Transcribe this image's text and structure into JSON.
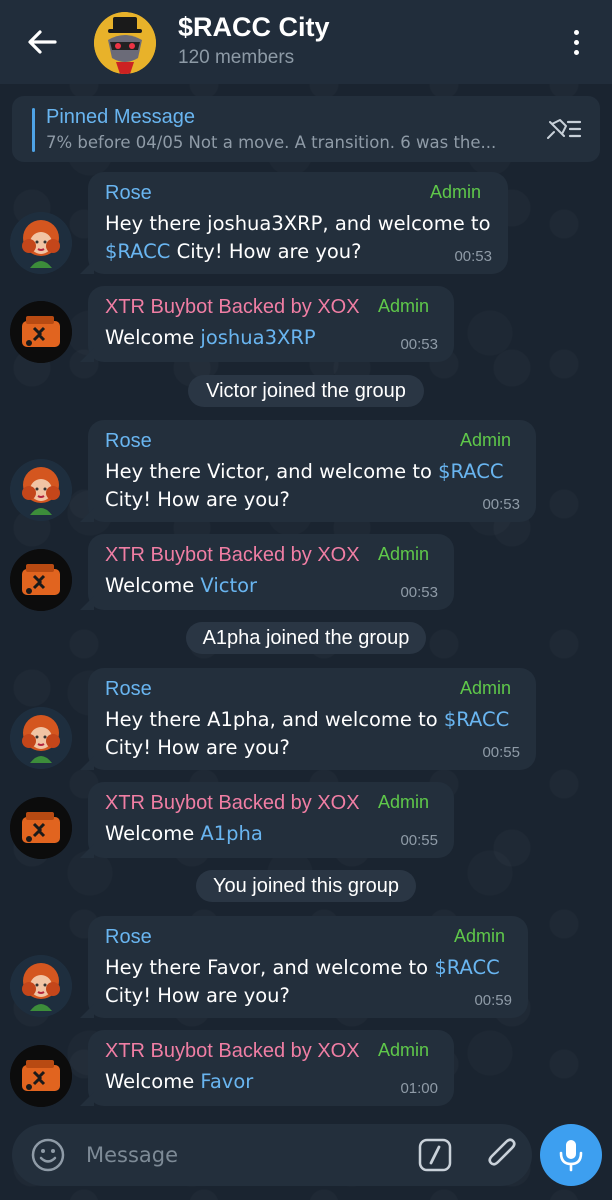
{
  "header": {
    "title": "$RACC City",
    "members": "120 members"
  },
  "pinned": {
    "title": "Pinned Message",
    "text": "7% before 04/05 Not a move. A transition. 6 was the..."
  },
  "messages": [
    {
      "sender": "Rose",
      "badge": "Admin",
      "line1_pre": "Hey there joshua3XRP, and welcome to",
      "line2_link": "$RACC",
      "line2_post": " City! How are you?",
      "time": "00:53"
    },
    {
      "sender": "XTR Buybot Backed by XOX",
      "badge": "Admin",
      "pre": "Welcome ",
      "link": "joshua3XRP",
      "time": "00:53"
    },
    {
      "service": "Victor joined the group"
    },
    {
      "sender": "Rose",
      "badge": "Admin",
      "line1_pre": "Hey there Victor, and welcome to ",
      "line1_link": "$RACC",
      "line2": "City! How are you?",
      "time": "00:53"
    },
    {
      "sender": "XTR Buybot Backed by XOX",
      "badge": "Admin",
      "pre": "Welcome ",
      "link": "Victor",
      "time": "00:53"
    },
    {
      "service": "A1pha joined the group"
    },
    {
      "sender": "Rose",
      "badge": "Admin",
      "line1_pre": "Hey there A1pha, and welcome to ",
      "line1_link": "$RACC",
      "line2": "City! How are you?",
      "time": "00:55"
    },
    {
      "sender": "XTR Buybot Backed by XOX",
      "badge": "Admin",
      "pre": "Welcome ",
      "link": "A1pha",
      "time": "00:55"
    },
    {
      "service": "You joined this group"
    },
    {
      "sender": "Rose",
      "badge": "Admin",
      "line1_pre": "Hey there Favor, and welcome to ",
      "line1_link": "$RACC",
      "line2": "City! How are you?",
      "time": "00:59"
    },
    {
      "sender": "XTR Buybot Backed by XOX",
      "badge": "Admin",
      "pre": "Welcome ",
      "link": "Favor",
      "time": "01:00"
    }
  ],
  "composer": {
    "placeholder": "Message"
  },
  "icons": {
    "back": "back-arrow-icon",
    "menu": "more-vertical-icon",
    "unpin": "unpin-list-icon",
    "emoji": "emoji-icon",
    "command": "slash-command-icon",
    "attach": "paperclip-icon",
    "mic": "microphone-icon"
  },
  "colors": {
    "accent": "#3d9ff0",
    "link": "#69b5f0",
    "admin": "#5fc84a",
    "bot_name": "#f07ea4",
    "bubble": "#232f3c"
  }
}
